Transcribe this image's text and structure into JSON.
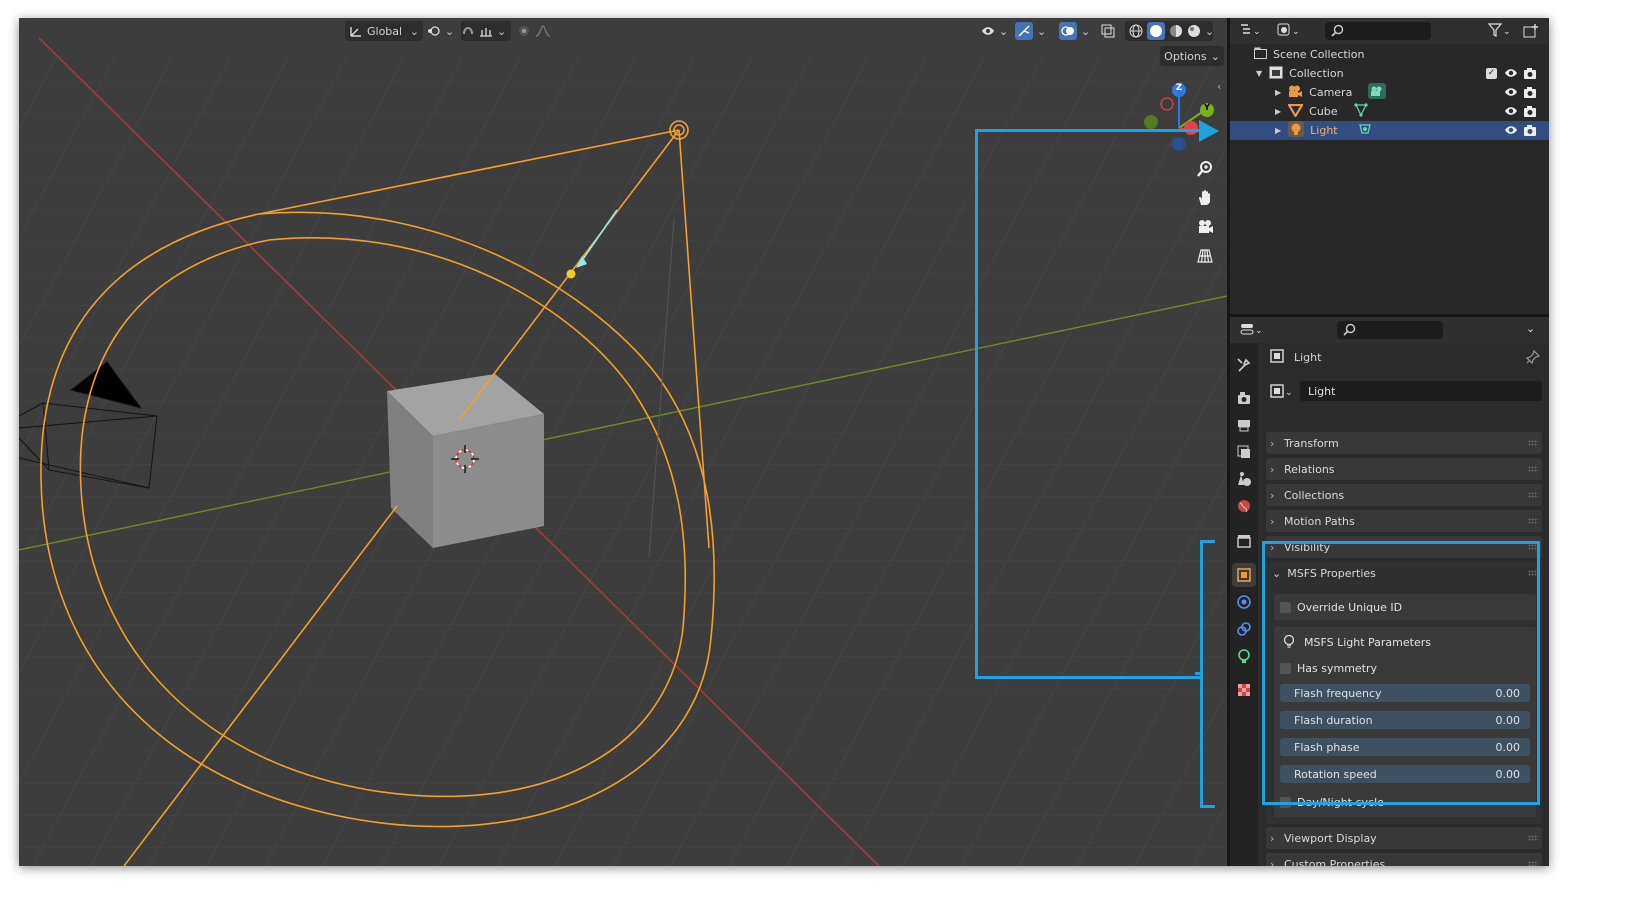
{
  "viewport": {
    "orientation": "Global",
    "options_label": "Options",
    "gizmo": {
      "z": "Z",
      "y": "Y"
    }
  },
  "outliner": {
    "root": "Scene Collection",
    "collection": "Collection",
    "items": [
      {
        "label": "Camera",
        "selected": false
      },
      {
        "label": "Cube",
        "selected": false
      },
      {
        "label": "Light",
        "selected": true
      }
    ]
  },
  "properties": {
    "object_name": "Light",
    "data_name": "Light",
    "panels_top": [
      "Transform",
      "Relations",
      "Collections",
      "Motion Paths",
      "Visibility"
    ],
    "msfs": {
      "title": "MSFS Properties",
      "override_id": "Override Unique ID",
      "light_params": "MSFS Light Parameters",
      "has_symmetry": "Has symmetry",
      "fields": [
        {
          "label": "Flash frequency",
          "value": "0.00"
        },
        {
          "label": "Flash duration",
          "value": "0.00"
        },
        {
          "label": "Flash phase",
          "value": "0.00"
        },
        {
          "label": "Rotation speed",
          "value": "0.00"
        }
      ],
      "day_night": "Day/Night cycle"
    },
    "panels_bottom": [
      "Viewport Display",
      "Custom Properties"
    ]
  },
  "colors": {
    "selection": "#334d80",
    "annotation": "#1fa3e0",
    "light_orange": "#f0a030",
    "x_axis": "#c83a3a",
    "y_axis": "#6a9a2a"
  }
}
